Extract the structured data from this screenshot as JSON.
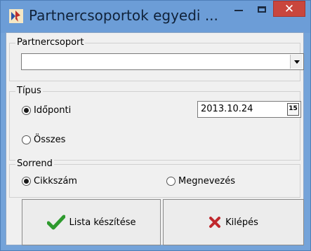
{
  "window": {
    "title": "Partnercsoportok egyedi ...",
    "close_glyph": "✕"
  },
  "partner_group": {
    "label": "Partnercsoport",
    "value": ""
  },
  "type_group": {
    "label": "Típus",
    "options": [
      {
        "label": "Időponti",
        "selected": true
      },
      {
        "label": "Összes",
        "selected": false
      }
    ],
    "date_value": "2013.10.24",
    "calendar_glyph": "15"
  },
  "order_group": {
    "label": "Sorrend",
    "options": [
      {
        "label": "Cikkszám",
        "selected": true
      },
      {
        "label": "Megnevezés",
        "selected": false
      }
    ]
  },
  "buttons": {
    "create_list": "Lista készítése",
    "exit": "Kilépés"
  },
  "colors": {
    "titlebar": "#6c9dd7",
    "close": "#c9463d",
    "check": "#2e9a2e",
    "x": "#c0282d"
  }
}
